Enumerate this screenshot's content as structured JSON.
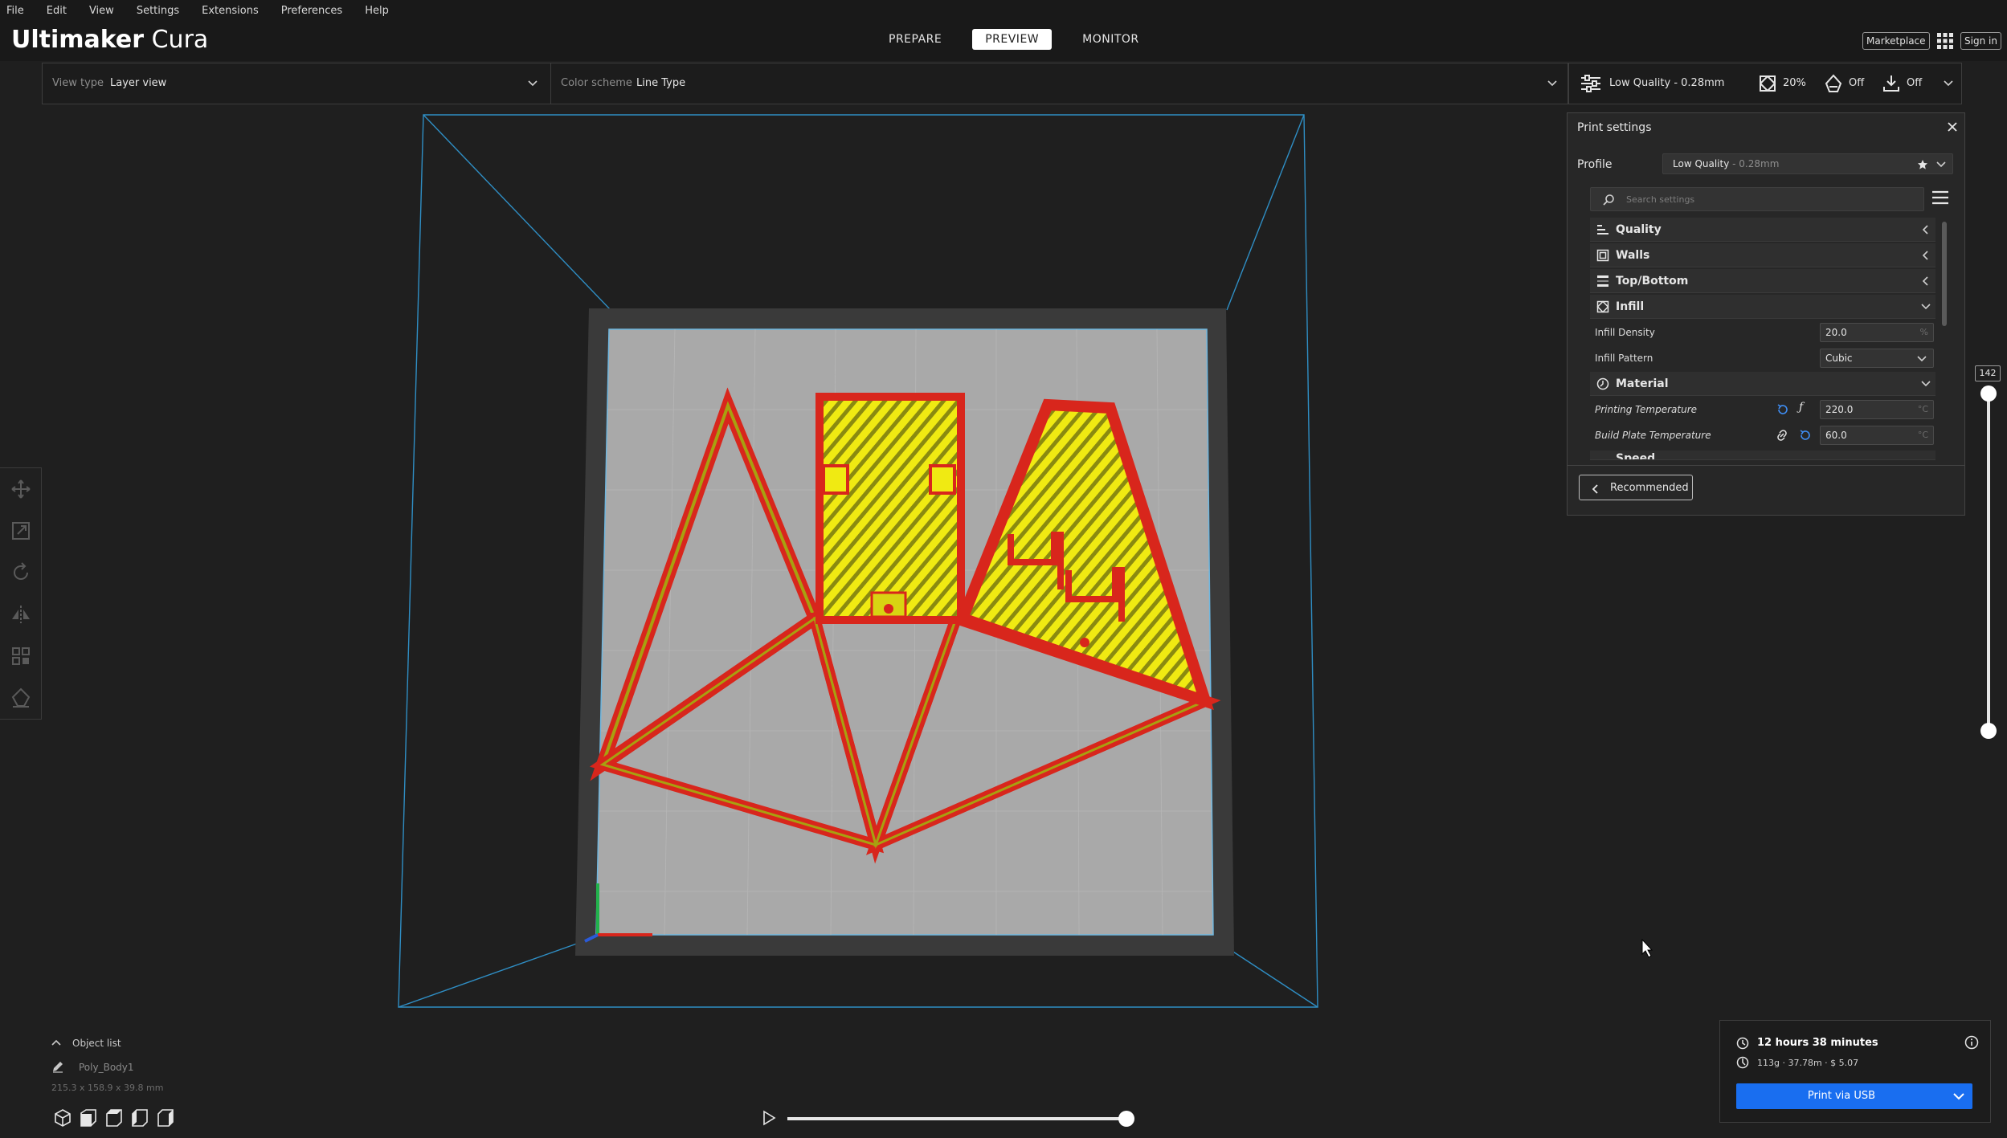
{
  "menu": [
    "File",
    "Edit",
    "View",
    "Settings",
    "Extensions",
    "Preferences",
    "Help"
  ],
  "header": {
    "brand_bold": "Ultimaker",
    "brand_light": "Cura",
    "tabs": [
      {
        "label": "PREPARE"
      },
      {
        "label": "PREVIEW",
        "active": true
      },
      {
        "label": "MONITOR"
      }
    ],
    "marketplace_label": "Marketplace",
    "signin_label": "Sign in"
  },
  "viewbar": {
    "view_type_label": "View type",
    "view_type_value": "Layer view",
    "color_scheme_label": "Color scheme",
    "color_scheme_value": "Line Type"
  },
  "summary": {
    "profile": "Low Quality - 0.28mm",
    "infill": "20%",
    "support": "Off",
    "adhesion": "Off"
  },
  "print_settings": {
    "title": "Print settings",
    "profile_label": "Profile",
    "profile_name": "Low Quality",
    "profile_layer": " - 0.28mm",
    "search_placeholder": "Search settings",
    "categories": {
      "quality": "Quality",
      "walls": "Walls",
      "top_bottom": "Top/Bottom",
      "infill": "Infill",
      "material": "Material",
      "speed": "Speed"
    },
    "infill_density": {
      "label": "Infill Density",
      "value": "20.0",
      "unit": "%"
    },
    "infill_pattern": {
      "label": "Infill Pattern",
      "value": "Cubic"
    },
    "printing_temperature": {
      "label": "Printing Temperature",
      "value": "220.0",
      "unit": "°C"
    },
    "build_plate_temperature": {
      "label": "Build Plate Temperature",
      "value": "60.0",
      "unit": "°C"
    },
    "recommended_label": "Recommended"
  },
  "layer_slider": {
    "current_layer": "142"
  },
  "object_list": {
    "header": "Object list",
    "object_name": "Poly_Body1",
    "dimensions": "215.3 x 158.9 x 39.8 mm"
  },
  "job": {
    "time": "12 hours 38 minutes",
    "cost": "113g · 37.78m · $ 5.07",
    "print_button": "Print via USB"
  },
  "colors": {
    "accent": "#196ef0",
    "wall": "#d8261c",
    "infill": "#f0ea12",
    "build_plate": "#a8a8a8",
    "frame": "#2f8ec4"
  },
  "icons": [
    "settings-sliders-icon",
    "infill-icon",
    "support-icon",
    "adhesion-icon",
    "apps-grid-icon",
    "search-icon",
    "hamburger-icon",
    "close-icon",
    "chevron-down-icon",
    "chevron-left-icon",
    "reset-icon",
    "function-icon",
    "link-icon",
    "play-icon",
    "clock-icon",
    "info-icon",
    "cost-icon",
    "pencil-icon"
  ]
}
